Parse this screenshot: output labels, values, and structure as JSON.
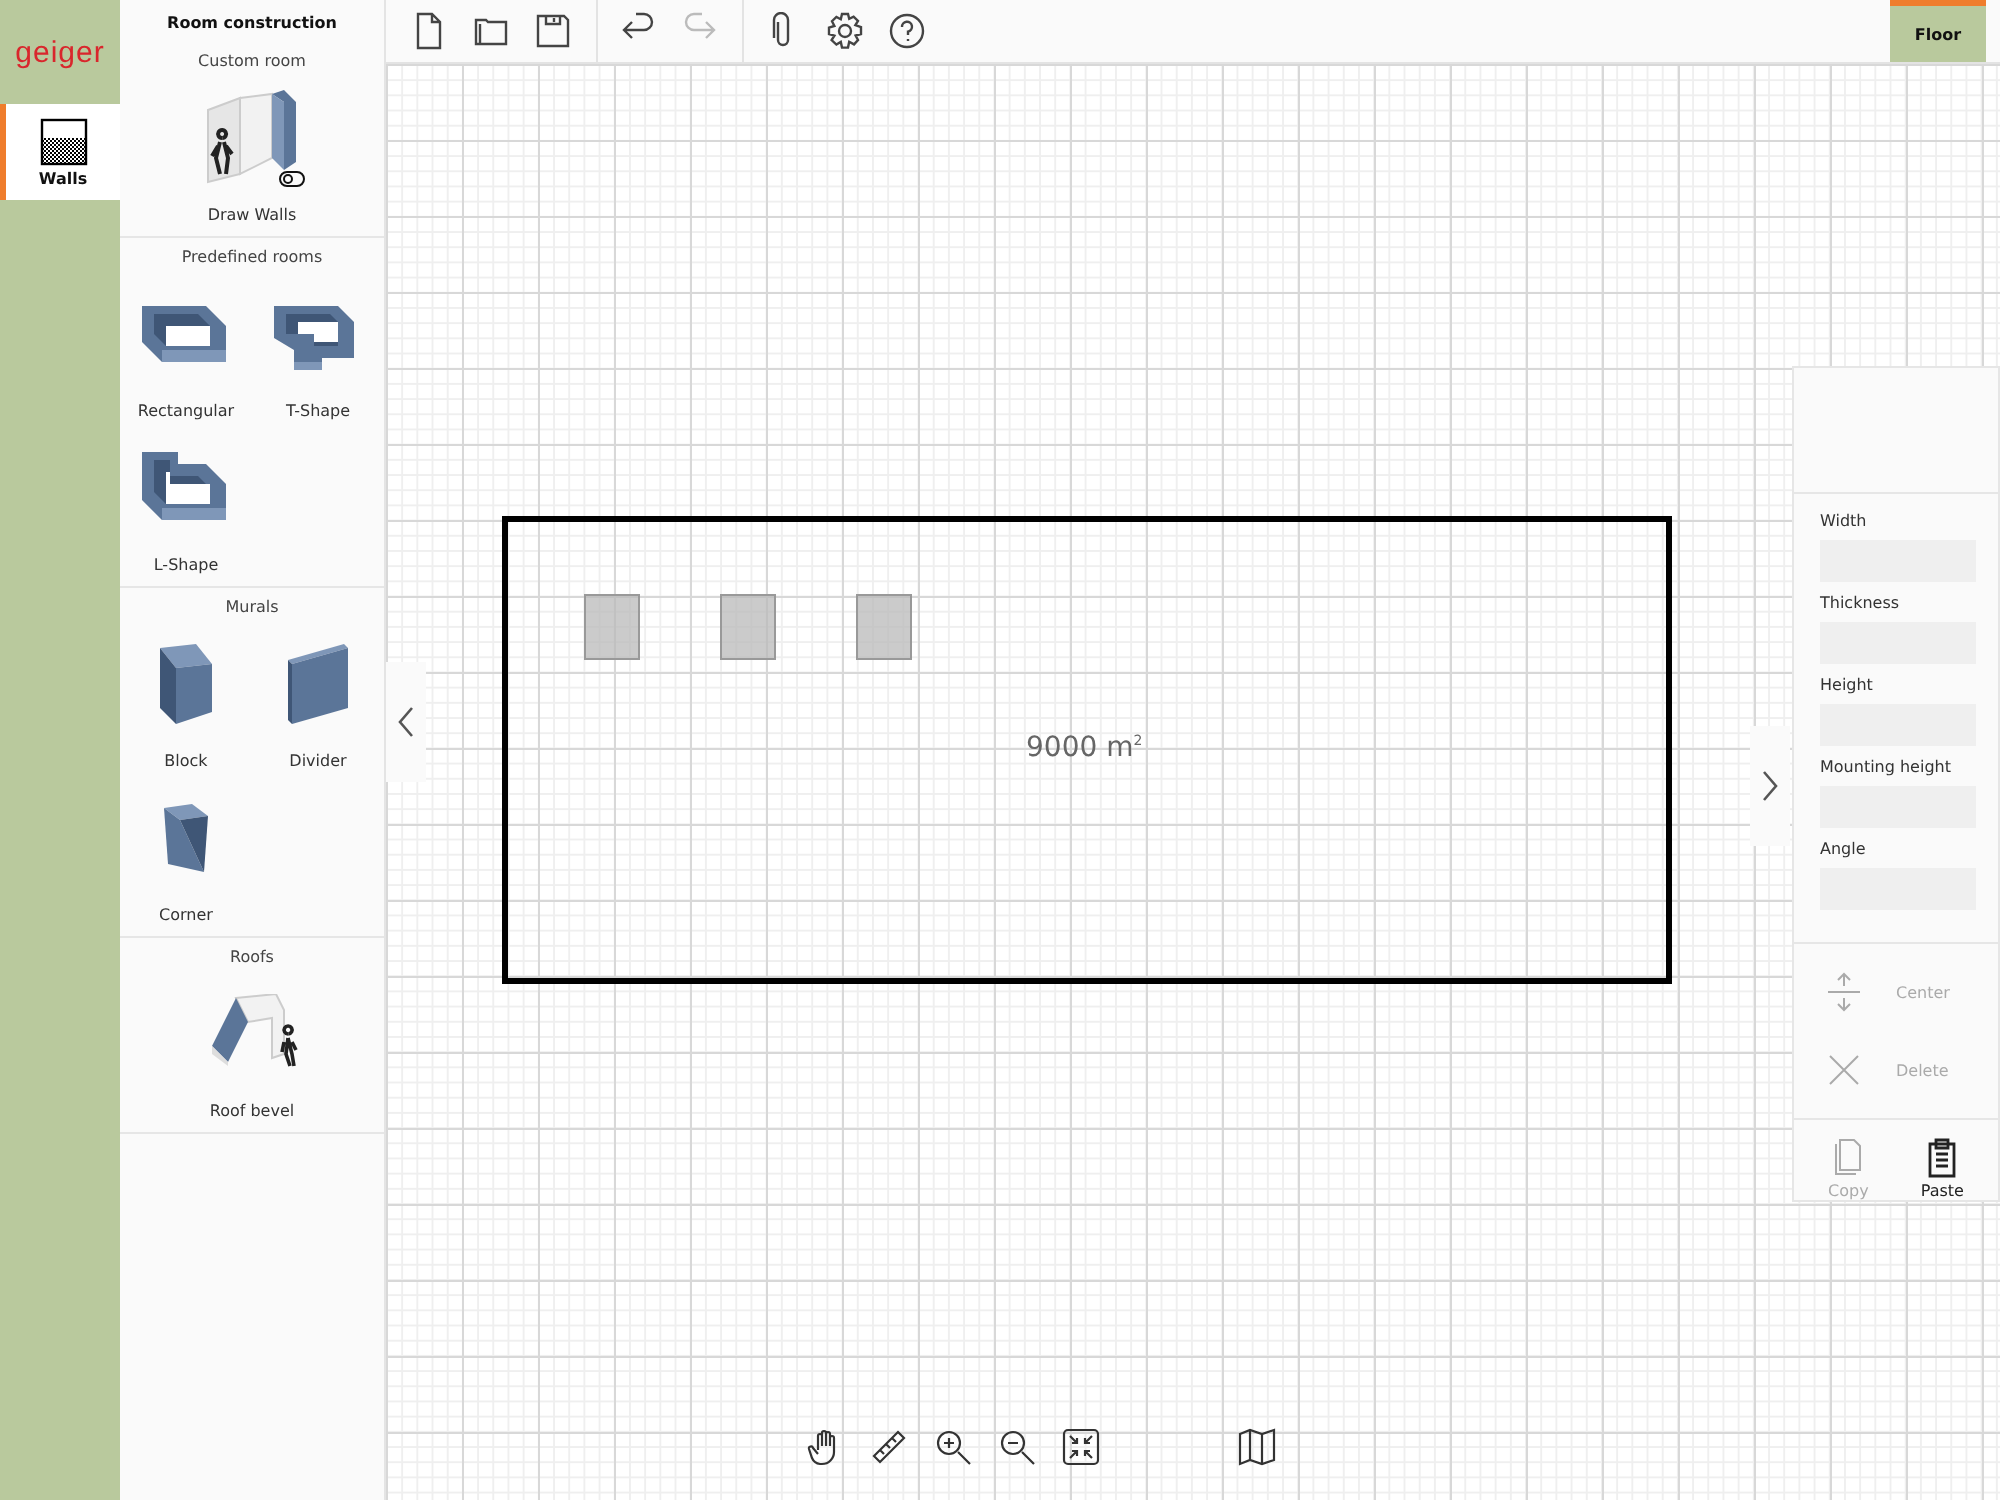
{
  "logo": "geiger",
  "rail_tabs": [
    {
      "label": "Walls",
      "selected": true
    }
  ],
  "palette": {
    "title": "Room construction",
    "sections": [
      {
        "heading": "Custom room",
        "items": [
          {
            "label": "Draw Walls",
            "kind": "draw-walls"
          }
        ]
      },
      {
        "heading": "Predefined rooms",
        "items": [
          {
            "label": "Rectangular",
            "kind": "rectangular"
          },
          {
            "label": "T-Shape",
            "kind": "t-shape"
          },
          {
            "label": "L-Shape",
            "kind": "l-shape"
          }
        ]
      },
      {
        "heading": "Murals",
        "items": [
          {
            "label": "Block",
            "kind": "block"
          },
          {
            "label": "Divider",
            "kind": "divider"
          },
          {
            "label": "Corner",
            "kind": "corner"
          }
        ]
      },
      {
        "heading": "Roofs",
        "items": [
          {
            "label": "Roof bevel",
            "kind": "roof-bevel"
          }
        ]
      }
    ]
  },
  "toolbar": [
    [
      {
        "kind": "new",
        "disabled": false
      },
      {
        "kind": "open",
        "disabled": false
      },
      {
        "kind": "save",
        "disabled": false
      }
    ],
    [
      {
        "kind": "undo",
        "disabled": false
      },
      {
        "kind": "redo",
        "disabled": true
      }
    ],
    [
      {
        "kind": "attach",
        "disabled": false
      },
      {
        "kind": "settings",
        "disabled": false
      },
      {
        "kind": "help",
        "disabled": false
      }
    ]
  ],
  "view_tabs": [
    {
      "label": "Floor",
      "selected": true
    }
  ],
  "canvas": {
    "area": "9000 m$^{2}$"
  },
  "properties": {
    "fields": [
      {
        "label": "Width"
      },
      {
        "label": "Thickness"
      },
      {
        "label": "Height"
      },
      {
        "label": "Mounting height"
      },
      {
        "label": "Angle"
      }
    ],
    "actions": [
      {
        "label": "Center",
        "kind": "center",
        "disabled": true
      },
      {
        "label": "Delete",
        "kind": "delete",
        "disabled": true
      }
    ],
    "clipboard": [
      {
        "label": "Copy",
        "kind": "copy",
        "disabled": true
      },
      {
        "label": "Paste",
        "kind": "paste",
        "disabled": false
      }
    ]
  }
}
